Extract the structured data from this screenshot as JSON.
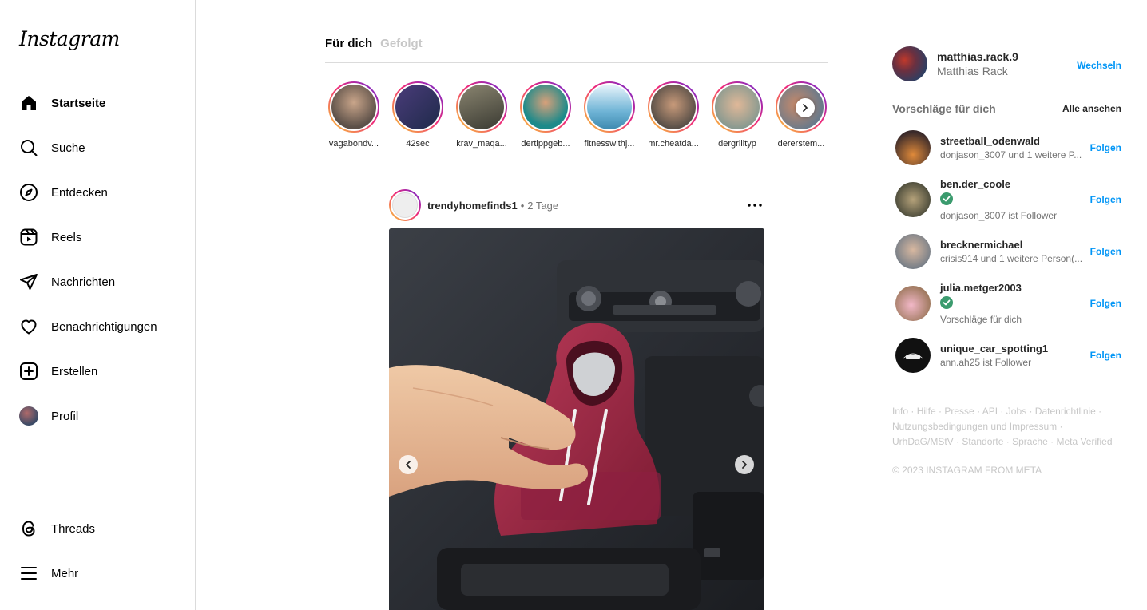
{
  "app": {
    "logo": "Instagram"
  },
  "nav": {
    "items": [
      {
        "label": "Startseite",
        "icon": "home-icon"
      },
      {
        "label": "Suche",
        "icon": "search-icon"
      },
      {
        "label": "Entdecken",
        "icon": "compass-icon"
      },
      {
        "label": "Reels",
        "icon": "reels-icon"
      },
      {
        "label": "Nachrichten",
        "icon": "send-icon"
      },
      {
        "label": "Benachrichtigungen",
        "icon": "heart-icon"
      },
      {
        "label": "Erstellen",
        "icon": "plus-square-icon"
      },
      {
        "label": "Profil",
        "icon": "avatar"
      }
    ],
    "bottom": [
      {
        "label": "Threads",
        "icon": "threads-icon"
      },
      {
        "label": "Mehr",
        "icon": "menu-icon"
      }
    ]
  },
  "feed": {
    "tabs": [
      "Für dich",
      "Gefolgt"
    ],
    "stories": [
      {
        "name": "vagabondv...",
        "color": "#8a7a6a"
      },
      {
        "name": "42sec",
        "color": "#3a3f6e"
      },
      {
        "name": "krav_maqa...",
        "color": "#6f6a55"
      },
      {
        "name": "dertippgeb...",
        "color": "#2a8f8f"
      },
      {
        "name": "fitnesswithj...",
        "color": "#6fb4d6"
      },
      {
        "name": "mr.cheatda...",
        "color": "#7a6a5a"
      },
      {
        "name": "dergrilltyp",
        "color": "#9aa6a0"
      },
      {
        "name": "dererstem...",
        "color": "#8a6a5a"
      }
    ],
    "post": {
      "user": "trendyhomefinds1",
      "separator": "•",
      "time": "2 Tage"
    }
  },
  "account": {
    "username": "matthias.rack.9",
    "fullname": "Matthias Rack",
    "switch_label": "Wechseln"
  },
  "suggestions": {
    "title": "Vorschläge für dich",
    "see_all": "Alle ansehen",
    "follow_label": "Folgen",
    "items": [
      {
        "username": "streetball_odenwald",
        "subtitle": "donjason_3007 und 1 weitere P...",
        "verified": false,
        "color": "#b8704a"
      },
      {
        "username": "ben.der_coole",
        "subtitle": "donjason_3007 ist Follower",
        "verified": true,
        "color": "#8a7b5a"
      },
      {
        "username": "brecknermichael",
        "subtitle": "crisis914 und 1 weitere Person(...",
        "verified": false,
        "color": "#9aa0a6"
      },
      {
        "username": "julia.metger2003",
        "subtitle": "Vorschläge für dich",
        "verified": true,
        "color": "#c99a88"
      },
      {
        "username": "unique_car_spotting1",
        "subtitle": "ann.ah25 ist Follower",
        "verified": false,
        "color": "#111111"
      }
    ]
  },
  "footer": {
    "links": [
      "Info",
      "Hilfe",
      "Presse",
      "API",
      "Jobs",
      "Datenrichtlinie",
      "Nutzungsbedingungen und Impressum",
      "UrhDaG/MStV",
      "Standorte",
      "Sprache",
      "Meta Verified"
    ],
    "copyright": "© 2023 INSTAGRAM FROM META"
  },
  "colors": {
    "accent": "#0095f6",
    "verified": "#3b9b6e"
  }
}
